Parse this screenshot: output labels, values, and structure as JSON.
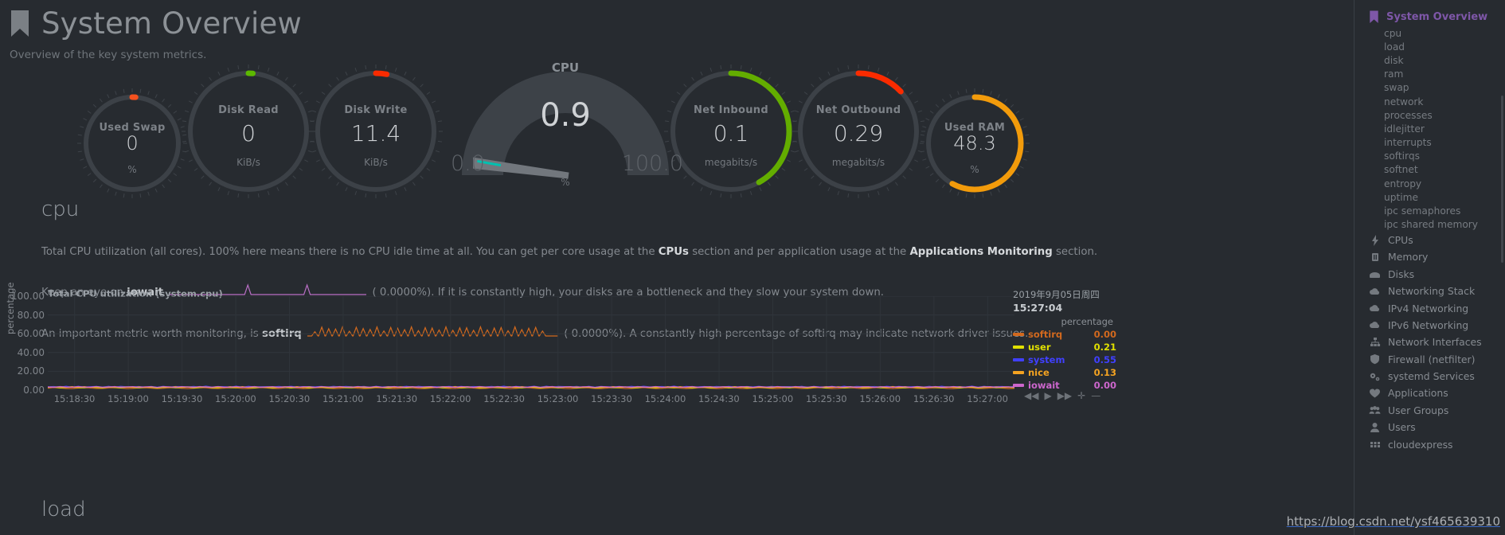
{
  "header": {
    "title": "System Overview",
    "subtitle": "Overview of the key system metrics.",
    "bookmark_icon": "bookmark-icon"
  },
  "gauges": [
    {
      "label": "Used Swap",
      "value": "0",
      "unit": "%",
      "pct": 0,
      "color": "#f4511e"
    },
    {
      "label": "Disk Read",
      "value": "0",
      "unit": "KiB/s",
      "pct": 0,
      "color": "#5cb800"
    },
    {
      "label": "Disk Write",
      "value": "11.4",
      "unit": "KiB/s",
      "pct": 3,
      "color": "#fa2b00"
    },
    {
      "label": "Net Inbound",
      "value": "0.1",
      "unit": "megabits/s",
      "pct": 42,
      "color": "#63ad00"
    },
    {
      "label": "Net Outbound",
      "value": "0.29",
      "unit": "megabits/s",
      "pct": 13,
      "color": "#fa2b00"
    },
    {
      "label": "Used RAM",
      "value": "48.3",
      "unit": "%",
      "pct": 58,
      "color": "#f29b0b"
    }
  ],
  "cpu_gauge": {
    "title": "CPU",
    "value": "0.9",
    "min_label": "0.0",
    "max_label": "100.0",
    "unit": "%",
    "needle_color": "#00c0b0"
  },
  "sections": {
    "cpu": {
      "heading": "cpu",
      "line1_a": "Total CPU utilization (all cores). 100% here means there is no CPU idle time at all. You can get per core usage at the ",
      "line1_link1": "CPUs",
      "line1_b": " section and per application usage at the ",
      "line1_link2": "Applications Monitoring",
      "line1_c": " section.",
      "line2_a": "Keep an eye on ",
      "line2_metric": "iowait",
      "line2_b": "( 0.0000%). If it is constantly high, your disks are a bottleneck and they slow your system down.",
      "line2_color": "#b86ec4",
      "line3_a": "An important metric worth monitoring, is ",
      "line3_metric": "softirq",
      "line3_b": "( 0.0000%). A constantly high percentage of softirq may indicate network driver issues.",
      "line3_color": "#d2691e"
    },
    "load": {
      "heading": "load"
    }
  },
  "chart_data": {
    "type": "area",
    "title": "Total CPU utilization (system.cpu)",
    "ylabel": "percentage",
    "xlabel": "",
    "ylim": [
      0,
      100
    ],
    "yticks": [
      "100.00",
      "80.00",
      "60.00",
      "40.00",
      "20.00",
      "0.00"
    ],
    "grid": true,
    "legend_position": "right",
    "categories": [
      "15:18:30",
      "15:19:00",
      "15:19:30",
      "15:20:00",
      "15:20:30",
      "15:21:00",
      "15:21:30",
      "15:22:00",
      "15:22:30",
      "15:23:00",
      "15:23:30",
      "15:24:00",
      "15:24:30",
      "15:25:00",
      "15:25:30",
      "15:26:00",
      "15:26:30",
      "15:27:00"
    ],
    "series": [
      {
        "name": "softirq",
        "color": "#d2691e",
        "value": "0.00",
        "values": [
          0.0,
          0.01,
          0.0,
          0.0,
          0.01,
          0.0,
          0.0,
          0.0,
          0.01,
          0.0,
          0.0,
          0.0,
          0.0,
          0.01,
          0.0,
          0.0,
          0.0,
          0.0
        ]
      },
      {
        "name": "user",
        "color": "#e0e000",
        "value": "0.21",
        "values": [
          0.21,
          0.25,
          0.2,
          0.3,
          0.22,
          0.28,
          0.21,
          0.24,
          0.33,
          0.21,
          0.27,
          0.22,
          0.25,
          0.31,
          0.2,
          0.26,
          0.23,
          0.21
        ]
      },
      {
        "name": "system",
        "color": "#4040ff",
        "value": "0.55",
        "values": [
          0.55,
          0.6,
          0.52,
          0.7,
          0.58,
          0.64,
          0.55,
          0.59,
          0.75,
          0.54,
          0.62,
          0.56,
          0.61,
          0.72,
          0.53,
          0.63,
          0.57,
          0.55
        ]
      },
      {
        "name": "nice",
        "color": "#f4a321",
        "value": "0.13",
        "values": [
          0.13,
          0.15,
          0.12,
          0.18,
          0.14,
          0.16,
          0.13,
          0.14,
          0.2,
          0.12,
          0.15,
          0.13,
          0.14,
          0.19,
          0.12,
          0.15,
          0.14,
          0.13
        ]
      },
      {
        "name": "iowait",
        "color": "#cc66cc",
        "value": "0.00",
        "values": [
          0.0,
          0.0,
          0.0,
          0.01,
          0.0,
          0.0,
          0.0,
          0.0,
          0.02,
          0.0,
          0.0,
          0.0,
          0.0,
          0.01,
          0.0,
          0.0,
          0.0,
          0.0
        ]
      }
    ],
    "legend": {
      "date": "2019年9月05日周四",
      "time": "15:27:04",
      "unit": "percentage"
    }
  },
  "chart_controls": [
    {
      "name": "rewind",
      "glyph": "◀◀"
    },
    {
      "name": "play",
      "glyph": "▶"
    },
    {
      "name": "fast-forward",
      "glyph": "▶▶"
    },
    {
      "name": "zoom-in",
      "glyph": "✛"
    },
    {
      "name": "zoom-out",
      "glyph": "—"
    }
  ],
  "sidebar": {
    "active": {
      "label": "System Overview",
      "icon": "bookmark-icon",
      "color": "#7e57a8"
    },
    "sub_items": [
      "cpu",
      "load",
      "disk",
      "ram",
      "swap",
      "network",
      "processes",
      "idlejitter",
      "interrupts",
      "softirqs",
      "softnet",
      "entropy",
      "uptime",
      "ipc semaphores",
      "ipc shared memory"
    ],
    "items": [
      {
        "label": "CPUs",
        "icon": "bolt-icon"
      },
      {
        "label": "Memory",
        "icon": "memory-chip-icon"
      },
      {
        "label": "Disks",
        "icon": "disk-icon"
      },
      {
        "label": "Networking Stack",
        "icon": "cloud-icon"
      },
      {
        "label": "IPv4 Networking",
        "icon": "cloud-icon"
      },
      {
        "label": "IPv6 Networking",
        "icon": "cloud-icon"
      },
      {
        "label": "Network Interfaces",
        "icon": "sitemap-icon"
      },
      {
        "label": "Firewall (netfilter)",
        "icon": "shield-icon"
      },
      {
        "label": "systemd Services",
        "icon": "cogs-icon"
      },
      {
        "label": "Applications",
        "icon": "heartbeat-icon"
      },
      {
        "label": "User Groups",
        "icon": "users-icon"
      },
      {
        "label": "Users",
        "icon": "user-icon"
      },
      {
        "label": "cloudexpress",
        "icon": "grid-icon"
      }
    ]
  },
  "watermark": "https://blog.csdn.net/ysf465639310"
}
